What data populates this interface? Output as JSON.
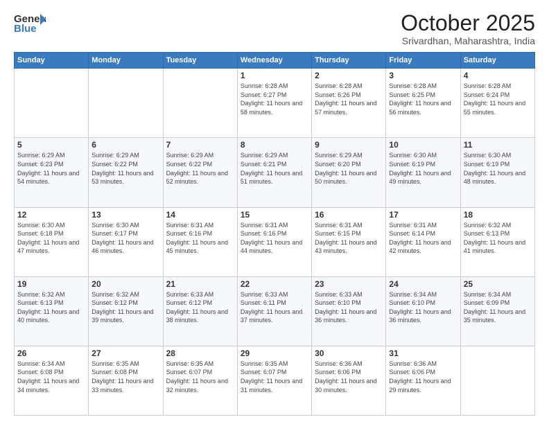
{
  "header": {
    "logo_general": "General",
    "logo_blue": "Blue",
    "month_title": "October 2025",
    "subtitle": "Srivardhan, Maharashtra, India"
  },
  "days_of_week": [
    "Sunday",
    "Monday",
    "Tuesday",
    "Wednesday",
    "Thursday",
    "Friday",
    "Saturday"
  ],
  "weeks": [
    [
      {
        "day": "",
        "sunrise": "",
        "sunset": "",
        "daylight": ""
      },
      {
        "day": "",
        "sunrise": "",
        "sunset": "",
        "daylight": ""
      },
      {
        "day": "",
        "sunrise": "",
        "sunset": "",
        "daylight": ""
      },
      {
        "day": "1",
        "sunrise": "Sunrise: 6:28 AM",
        "sunset": "Sunset: 6:27 PM",
        "daylight": "Daylight: 11 hours and 58 minutes."
      },
      {
        "day": "2",
        "sunrise": "Sunrise: 6:28 AM",
        "sunset": "Sunset: 6:26 PM",
        "daylight": "Daylight: 11 hours and 57 minutes."
      },
      {
        "day": "3",
        "sunrise": "Sunrise: 6:28 AM",
        "sunset": "Sunset: 6:25 PM",
        "daylight": "Daylight: 11 hours and 56 minutes."
      },
      {
        "day": "4",
        "sunrise": "Sunrise: 6:28 AM",
        "sunset": "Sunset: 6:24 PM",
        "daylight": "Daylight: 11 hours and 55 minutes."
      }
    ],
    [
      {
        "day": "5",
        "sunrise": "Sunrise: 6:29 AM",
        "sunset": "Sunset: 6:23 PM",
        "daylight": "Daylight: 11 hours and 54 minutes."
      },
      {
        "day": "6",
        "sunrise": "Sunrise: 6:29 AM",
        "sunset": "Sunset: 6:22 PM",
        "daylight": "Daylight: 11 hours and 53 minutes."
      },
      {
        "day": "7",
        "sunrise": "Sunrise: 6:29 AM",
        "sunset": "Sunset: 6:22 PM",
        "daylight": "Daylight: 11 hours and 52 minutes."
      },
      {
        "day": "8",
        "sunrise": "Sunrise: 6:29 AM",
        "sunset": "Sunset: 6:21 PM",
        "daylight": "Daylight: 11 hours and 51 minutes."
      },
      {
        "day": "9",
        "sunrise": "Sunrise: 6:29 AM",
        "sunset": "Sunset: 6:20 PM",
        "daylight": "Daylight: 11 hours and 50 minutes."
      },
      {
        "day": "10",
        "sunrise": "Sunrise: 6:30 AM",
        "sunset": "Sunset: 6:19 PM",
        "daylight": "Daylight: 11 hours and 49 minutes."
      },
      {
        "day": "11",
        "sunrise": "Sunrise: 6:30 AM",
        "sunset": "Sunset: 6:19 PM",
        "daylight": "Daylight: 11 hours and 48 minutes."
      }
    ],
    [
      {
        "day": "12",
        "sunrise": "Sunrise: 6:30 AM",
        "sunset": "Sunset: 6:18 PM",
        "daylight": "Daylight: 11 hours and 47 minutes."
      },
      {
        "day": "13",
        "sunrise": "Sunrise: 6:30 AM",
        "sunset": "Sunset: 6:17 PM",
        "daylight": "Daylight: 11 hours and 46 minutes."
      },
      {
        "day": "14",
        "sunrise": "Sunrise: 6:31 AM",
        "sunset": "Sunset: 6:16 PM",
        "daylight": "Daylight: 11 hours and 45 minutes."
      },
      {
        "day": "15",
        "sunrise": "Sunrise: 6:31 AM",
        "sunset": "Sunset: 6:16 PM",
        "daylight": "Daylight: 11 hours and 44 minutes."
      },
      {
        "day": "16",
        "sunrise": "Sunrise: 6:31 AM",
        "sunset": "Sunset: 6:15 PM",
        "daylight": "Daylight: 11 hours and 43 minutes."
      },
      {
        "day": "17",
        "sunrise": "Sunrise: 6:31 AM",
        "sunset": "Sunset: 6:14 PM",
        "daylight": "Daylight: 11 hours and 42 minutes."
      },
      {
        "day": "18",
        "sunrise": "Sunrise: 6:32 AM",
        "sunset": "Sunset: 6:13 PM",
        "daylight": "Daylight: 11 hours and 41 minutes."
      }
    ],
    [
      {
        "day": "19",
        "sunrise": "Sunrise: 6:32 AM",
        "sunset": "Sunset: 6:13 PM",
        "daylight": "Daylight: 11 hours and 40 minutes."
      },
      {
        "day": "20",
        "sunrise": "Sunrise: 6:32 AM",
        "sunset": "Sunset: 6:12 PM",
        "daylight": "Daylight: 11 hours and 39 minutes."
      },
      {
        "day": "21",
        "sunrise": "Sunrise: 6:33 AM",
        "sunset": "Sunset: 6:12 PM",
        "daylight": "Daylight: 11 hours and 38 minutes."
      },
      {
        "day": "22",
        "sunrise": "Sunrise: 6:33 AM",
        "sunset": "Sunset: 6:11 PM",
        "daylight": "Daylight: 11 hours and 37 minutes."
      },
      {
        "day": "23",
        "sunrise": "Sunrise: 6:33 AM",
        "sunset": "Sunset: 6:10 PM",
        "daylight": "Daylight: 11 hours and 36 minutes."
      },
      {
        "day": "24",
        "sunrise": "Sunrise: 6:34 AM",
        "sunset": "Sunset: 6:10 PM",
        "daylight": "Daylight: 11 hours and 36 minutes."
      },
      {
        "day": "25",
        "sunrise": "Sunrise: 6:34 AM",
        "sunset": "Sunset: 6:09 PM",
        "daylight": "Daylight: 11 hours and 35 minutes."
      }
    ],
    [
      {
        "day": "26",
        "sunrise": "Sunrise: 6:34 AM",
        "sunset": "Sunset: 6:08 PM",
        "daylight": "Daylight: 11 hours and 34 minutes."
      },
      {
        "day": "27",
        "sunrise": "Sunrise: 6:35 AM",
        "sunset": "Sunset: 6:08 PM",
        "daylight": "Daylight: 11 hours and 33 minutes."
      },
      {
        "day": "28",
        "sunrise": "Sunrise: 6:35 AM",
        "sunset": "Sunset: 6:07 PM",
        "daylight": "Daylight: 11 hours and 32 minutes."
      },
      {
        "day": "29",
        "sunrise": "Sunrise: 6:35 AM",
        "sunset": "Sunset: 6:07 PM",
        "daylight": "Daylight: 11 hours and 31 minutes."
      },
      {
        "day": "30",
        "sunrise": "Sunrise: 6:36 AM",
        "sunset": "Sunset: 6:06 PM",
        "daylight": "Daylight: 11 hours and 30 minutes."
      },
      {
        "day": "31",
        "sunrise": "Sunrise: 6:36 AM",
        "sunset": "Sunset: 6:06 PM",
        "daylight": "Daylight: 11 hours and 29 minutes."
      },
      {
        "day": "",
        "sunrise": "",
        "sunset": "",
        "daylight": ""
      }
    ]
  ]
}
